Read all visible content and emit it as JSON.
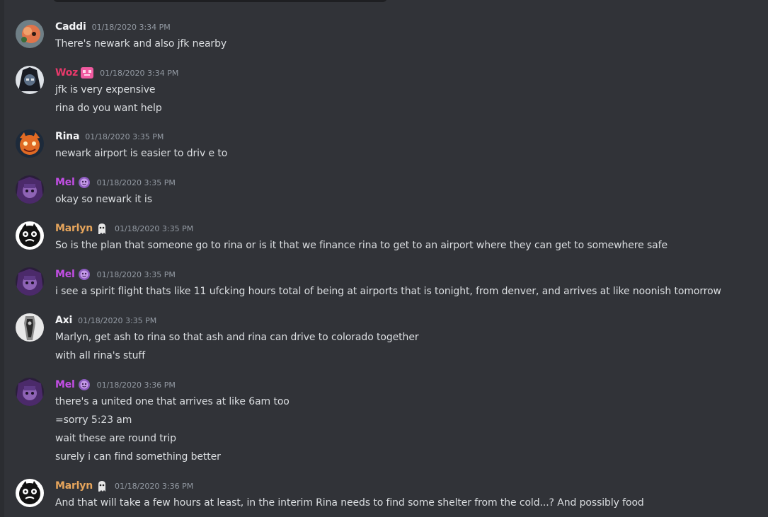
{
  "messages": [
    {
      "author": "Caddi",
      "color": "#f2f3f5",
      "badge": "",
      "timestamp": "01/18/2020 3:34 PM",
      "avatar": "caddi-avatar",
      "lines": [
        "There's newark and also jfk nearby"
      ]
    },
    {
      "author": "Woz",
      "color": "#e8396b",
      "badge": "pink-pixel-badge-icon",
      "timestamp": "01/18/2020 3:34 PM",
      "avatar": "woz-avatar",
      "lines": [
        "jfk is very expensive",
        "rina do you want help"
      ]
    },
    {
      "author": "Rina",
      "color": "#f2f3f5",
      "badge": "",
      "timestamp": "01/18/2020 3:35 PM",
      "avatar": "rina-avatar",
      "lines": [
        "newark airport is easier to driv e to"
      ]
    },
    {
      "author": "Mel",
      "color": "#c34ee6",
      "badge": "purple-face-badge-icon",
      "timestamp": "01/18/2020 3:35 PM",
      "avatar": "mel-avatar",
      "lines": [
        "okay so newark it is"
      ]
    },
    {
      "author": "Marlyn",
      "color": "#e6a55c",
      "badge": "ghost-badge-icon",
      "timestamp": "01/18/2020 3:35 PM",
      "avatar": "marlyn-avatar",
      "lines": [
        "So is the plan that someone go to rina or is it that we finance rina to get to an airport where they can get to somewhere safe"
      ]
    },
    {
      "author": "Mel",
      "color": "#c34ee6",
      "badge": "purple-face-badge-icon",
      "timestamp": "01/18/2020 3:35 PM",
      "avatar": "mel-avatar",
      "lines": [
        "i see a spirit flight thats like 11 ufcking hours total of being at airports that is tonight, from denver, and arrives at like noonish tomorrow"
      ]
    },
    {
      "author": "Axi",
      "color": "#f2f3f5",
      "badge": "",
      "timestamp": "01/18/2020 3:35 PM",
      "avatar": "axi-avatar",
      "lines": [
        "Marlyn, get ash to rina so that ash and rina can drive to colorado together",
        "with all rina's stuff"
      ]
    },
    {
      "author": "Mel",
      "color": "#c34ee6",
      "badge": "purple-face-badge-icon",
      "timestamp": "01/18/2020 3:36 PM",
      "avatar": "mel-avatar",
      "lines": [
        "there's a united one that arrives at like 6am too",
        "=sorry 5:23 am",
        "wait these are round trip",
        "surely i can find something better"
      ]
    },
    {
      "author": "Marlyn",
      "color": "#e6a55c",
      "badge": "ghost-badge-icon",
      "timestamp": "01/18/2020 3:36 PM",
      "avatar": "marlyn-avatar",
      "lines": [
        "And that will take a few hours at least, in the interim Rina needs to find some shelter from the cold...? And possibly food"
      ]
    }
  ]
}
